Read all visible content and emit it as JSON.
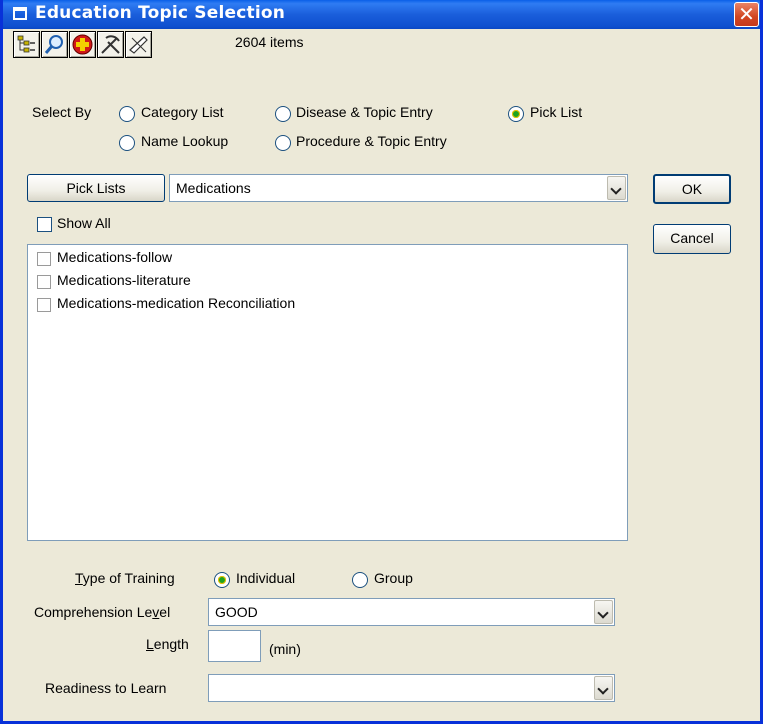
{
  "window": {
    "title": "Education Topic Selection",
    "close_glyph": "✕",
    "title_icon": "window-list-icon"
  },
  "toolbar": {
    "icons": [
      "tree-outline-icon",
      "magnifier-search-icon",
      "medical-cross-icon",
      "tools-pick-icon",
      "edit-pencil-icon"
    ],
    "items_count": "2604 items"
  },
  "select_by": {
    "label": "Select By",
    "options": [
      {
        "label": "Category List",
        "checked": false
      },
      {
        "label": "Disease & Topic Entry",
        "checked": false
      },
      {
        "label": "Pick List",
        "checked": true
      },
      {
        "label": "Name Lookup",
        "checked": false
      },
      {
        "label": "Procedure & Topic Entry",
        "checked": false
      }
    ]
  },
  "pick_lists": {
    "button_label": "Pick Lists",
    "selected": "Medications"
  },
  "show_all": {
    "label": "Show All",
    "checked": false
  },
  "topics": [
    {
      "label": "Medications-follow",
      "checked": false
    },
    {
      "label": "Medications-literature",
      "checked": false
    },
    {
      "label": "Medications-medication Reconciliation",
      "checked": false
    }
  ],
  "buttons": {
    "ok": "OK",
    "cancel": "Cancel"
  },
  "type_of_training": {
    "label_prefix": "T",
    "label_rest": "ype of Training",
    "options": [
      {
        "label": "Individual",
        "checked": true
      },
      {
        "label": "Group",
        "checked": false
      }
    ]
  },
  "comprehension": {
    "label_pre": "Comprehension Le",
    "label_u": "v",
    "label_post": "el",
    "value": "GOOD"
  },
  "length": {
    "label_u": "L",
    "label_rest": "ength",
    "value": "",
    "unit": "(min)"
  },
  "readiness": {
    "label": "Readiness to Learn",
    "value": ""
  }
}
